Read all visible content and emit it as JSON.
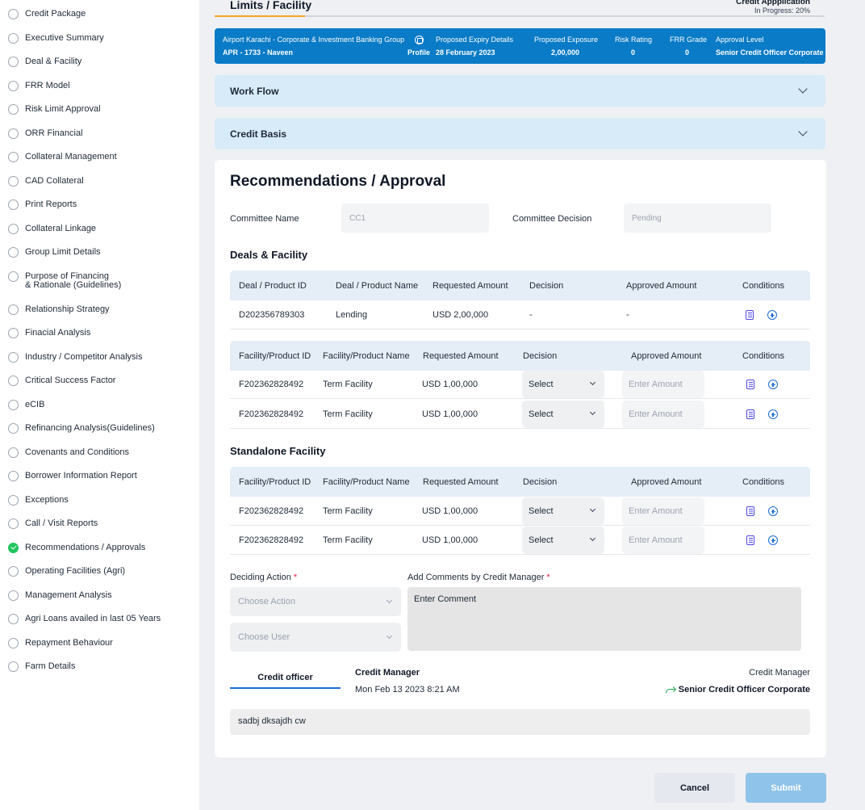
{
  "sidebar": {
    "items": [
      {
        "label": "Credit  Package",
        "done": false
      },
      {
        "label": "Executive Summary",
        "done": false
      },
      {
        "label": "Deal & Facility",
        "done": false
      },
      {
        "label": "FRR Model",
        "done": false
      },
      {
        "label": "Risk Limit Approval",
        "done": false
      },
      {
        "label": "ORR Financial",
        "done": false
      },
      {
        "label": "Collateral Management",
        "done": false
      },
      {
        "label": "CAD Collateral",
        "done": false
      },
      {
        "label": "Print Reports",
        "done": false
      },
      {
        "label": "Collateral Linkage",
        "done": false
      },
      {
        "label": "Group Limit Details",
        "done": false
      },
      {
        "label": "Purpose of Financing\n& Rationale (Guidelines)",
        "done": false
      },
      {
        "label": "Relationship Strategy",
        "done": false
      },
      {
        "label": "Finacial Analysis",
        "done": false
      },
      {
        "label": "Industry / Competitor Analysis",
        "done": false
      },
      {
        "label": "Critical Success Factor",
        "done": false
      },
      {
        "label": "eCIB",
        "done": false
      },
      {
        "label": "Refinancing Analysis(Guidelines)",
        "done": false
      },
      {
        "label": "Covenants and Conditions",
        "done": false
      },
      {
        "label": "Borrower Information Report",
        "done": false
      },
      {
        "label": "Exceptions",
        "done": false
      },
      {
        "label": "Call / Visit Reports",
        "done": false
      },
      {
        "label": "Recommendations / Approvals",
        "done": true
      },
      {
        "label": "Operating Facilities (Agri)",
        "done": false
      },
      {
        "label": "Management Analysis",
        "done": false
      },
      {
        "label": "Agri Loans availed in last 05 Years",
        "done": false
      },
      {
        "label": "Repayment Behaviour",
        "done": false
      },
      {
        "label": "Farm Details",
        "done": false
      }
    ]
  },
  "header": {
    "title": "Limits / Facility",
    "app_title": "Credit Appplication",
    "progress_text": "In Progress: 20%"
  },
  "info_bar": {
    "group": "Airport Karachi - Corporate & Investment Banking Group",
    "app_ref": "APR - 1733 - Naveen",
    "profile_label": "Profile",
    "expiry_label": "Proposed Expiry Details",
    "expiry_value": "28 February 2023",
    "exposure_label": "Proposed Exposure",
    "exposure_value": "2,00,000",
    "risk_label": "Risk Rating",
    "risk_value": "0",
    "frr_label": "FRR Grade",
    "frr_value": "0",
    "approval_label": "Approval Level",
    "approval_value": "Senior Credit Officer Corporate"
  },
  "accordions": {
    "workflow": "Work Flow",
    "credit_basis": "Credit Basis"
  },
  "recommendations": {
    "title": "Recommendations / Approval",
    "committee_name_label": "Committee Name",
    "committee_name_value": "CC1",
    "committee_decision_label": "Committee Decision",
    "committee_decision_value": "Pending"
  },
  "deals": {
    "title": "Deals & Facility",
    "deal_headers": [
      "Deal / Product ID",
      "Deal / Product Name",
      "Requested Amount",
      "Decision",
      "Approved Amount",
      "Conditions"
    ],
    "deal_rows": [
      {
        "id": "D202356789303",
        "name": "Lending",
        "requested": "USD 2,00,000",
        "decision": "-",
        "approved": "-"
      }
    ],
    "facility_headers": [
      "Facility/Product ID",
      "Facility/Product Name",
      "Requested Amount",
      "Decision",
      "Approved Amount",
      "Conditions"
    ],
    "facility_rows": [
      {
        "id": "F202362828492",
        "name": "Term Facility",
        "requested": "USD 1,00,000",
        "decision": "Select",
        "amount_placeholder": "Enter Amount"
      },
      {
        "id": "F202362828492",
        "name": "Term Facility",
        "requested": "USD 1,00,000",
        "decision": "Select",
        "amount_placeholder": "Enter Amount"
      }
    ]
  },
  "standalone": {
    "title": "Standalone Facility",
    "headers": [
      "Facility/Product ID",
      "Facility/Product Name",
      "Requested Amount",
      "Decision",
      "Approved Amount",
      "Conditions"
    ],
    "rows": [
      {
        "id": "F202362828492",
        "name": "Term Facility",
        "requested": "USD 1,00,000",
        "decision": "Select",
        "amount_placeholder": "Enter Amount"
      },
      {
        "id": "F202362828492",
        "name": "Term Facility",
        "requested": "USD 1,00,000",
        "decision": "Select",
        "amount_placeholder": "Enter Amount"
      }
    ]
  },
  "action": {
    "deciding_label": "Deciding Action",
    "required_mark": "*",
    "choose_action": "Choose Action",
    "choose_user": "Choose User",
    "comments_label": "Add Comments by Credit Manager",
    "comment_placeholder": "Enter Comment"
  },
  "history": {
    "tab_label": "Credit officer",
    "from_role": "Credit Manager",
    "timestamp": "Mon Feb 13 2023 8:21 AM",
    "to_role_label": "Credit Manager",
    "to_role": "Senior Credit Officer Corporate",
    "note": "sadbj dksajdh cw"
  },
  "buttons": {
    "cancel": "Cancel",
    "submit": "Submit"
  },
  "colors": {
    "brand_blue": "#0a7bc6",
    "accordion_bg": "#d7ebf8",
    "accent_orange": "#f5a623",
    "done_green": "#22c55e",
    "submit_disabled": "#8fc3ea"
  }
}
